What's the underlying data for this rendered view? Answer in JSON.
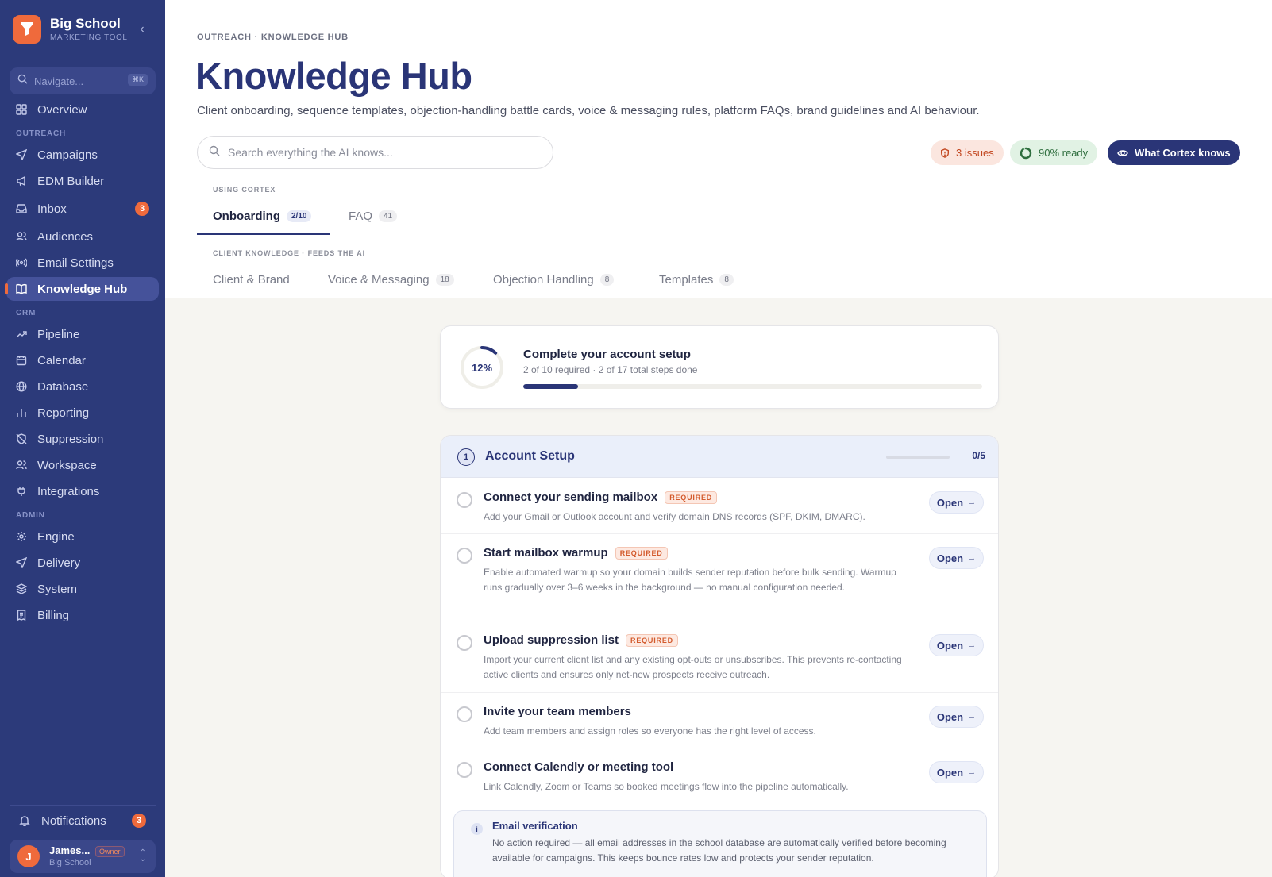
{
  "brand": {
    "name": "Big School",
    "subtitle": "MARKETING TOOL",
    "collapse": "‹"
  },
  "nav_search": {
    "placeholder": "Navigate...",
    "shortcut": "⌘K"
  },
  "nav": {
    "overview": "Overview",
    "section_outreach": "OUTREACH",
    "campaigns": "Campaigns",
    "edm_builder": "EDM Builder",
    "inbox": "Inbox",
    "inbox_badge": "3",
    "audiences": "Audiences",
    "email_settings": "Email Settings",
    "knowledge_hub": "Knowledge Hub",
    "section_crm": "CRM",
    "pipeline": "Pipeline",
    "calendar": "Calendar",
    "database": "Database",
    "reporting": "Reporting",
    "suppression": "Suppression",
    "workspace": "Workspace",
    "integrations": "Integrations",
    "section_admin": "ADMIN",
    "engine": "Engine",
    "delivery": "Delivery",
    "system": "System",
    "billing": "Billing"
  },
  "notifications": {
    "label": "Notifications",
    "badge": "3"
  },
  "user": {
    "initial": "J",
    "name": "James...",
    "role": "Owner",
    "org": "Big School"
  },
  "header": {
    "breadcrumb": "OUTREACH · KNOWLEDGE HUB",
    "title": "Knowledge Hub",
    "subtitle": "Client onboarding, sequence templates, objection-handling battle cards, voice & messaging rules, platform FAQs, brand guidelines and AI behaviour.",
    "search_placeholder": "Search everything the AI knows...",
    "issues": "3 issues",
    "ready": "90% ready",
    "ready_fraction": 0.9,
    "cortex_button": "What Cortex knows"
  },
  "tabs": {
    "section_cortex": "USING CORTEX",
    "onboarding": "Onboarding",
    "onboarding_count": "2/10",
    "faq": "FAQ",
    "faq_count": "41",
    "section_client": "CLIENT KNOWLEDGE · FEEDS THE AI",
    "client_brand": "Client & Brand",
    "voice": "Voice & Messaging",
    "voice_count": "18",
    "objection": "Objection Handling",
    "objection_count": "8",
    "templates": "Templates",
    "templates_count": "8"
  },
  "setup": {
    "percent_label": "12%",
    "percent": 12,
    "title": "Complete your account setup",
    "subtitle": "2 of 10 required · 2 of 17 total steps done"
  },
  "account": {
    "step": "1",
    "title": "Account Setup",
    "count": "0/5",
    "progress": 0,
    "required_label": "REQUIRED",
    "open_label": "Open",
    "tasks": [
      {
        "title": "Connect your sending mailbox",
        "desc": "Add your Gmail or Outlook account and verify domain DNS records (SPF, DKIM, DMARC)."
      },
      {
        "title": "Start mailbox warmup",
        "desc": "Enable automated warmup so your domain builds sender reputation before bulk sending. Warmup runs gradually over 3–6 weeks in the background — no manual configuration needed."
      },
      {
        "title": "Upload suppression list",
        "desc": "Import your current client list and any existing opt-outs or unsubscribes. This prevents re-contacting active clients and ensures only net-new prospects receive outreach."
      },
      {
        "title": "Invite your team members",
        "desc": "Add team members and assign roles so everyone has the right level of access."
      },
      {
        "title": "Connect Calendly or meeting tool",
        "desc": "Link Calendly, Zoom or Teams so booked meetings flow into the pipeline automatically."
      }
    ]
  },
  "info": {
    "icon": "i",
    "title": "Email verification",
    "text": "No action required — all email addresses in the school database are automatically verified before becoming available for campaigns. This keeps bounce rates low and protects your sender reputation."
  },
  "colors": {
    "sidebar": "#2c3a7a",
    "accent": "#ef6a3c",
    "navy": "#2a3577",
    "ready": "#2e6e3e"
  }
}
